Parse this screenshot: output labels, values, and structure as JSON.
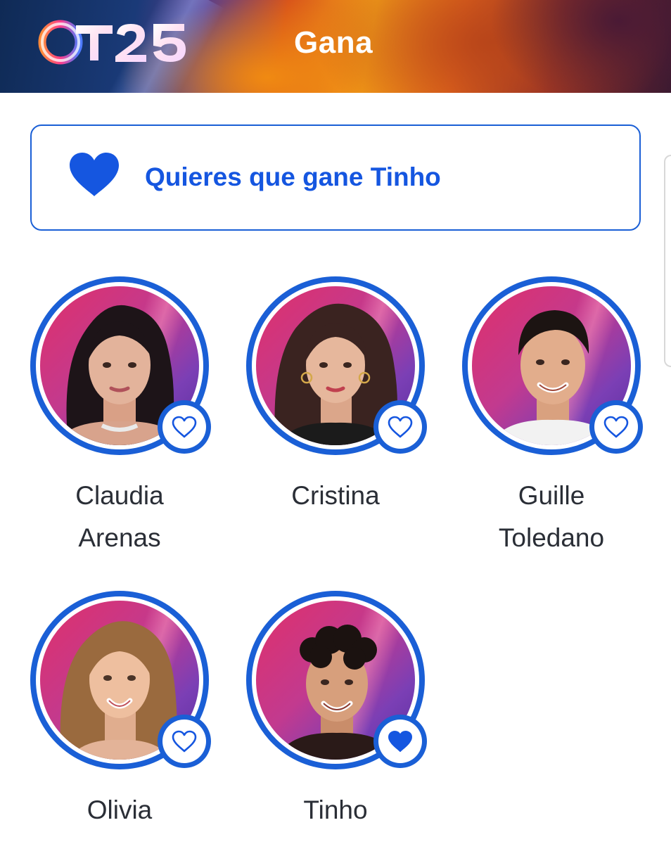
{
  "header": {
    "logo_text": "OT25",
    "title": "Gana"
  },
  "vote_banner": {
    "icon": "heart-filled-icon",
    "text": "Quieres que gane Tinho"
  },
  "colors": {
    "accent": "#1a5fd6",
    "banner_text": "#1556e0",
    "name_text": "#2a2e36"
  },
  "contestants": [
    {
      "name_line1": "Claudia",
      "name_line2": "Arenas",
      "favorite": false,
      "icon": "heart-outline-icon"
    },
    {
      "name_line1": "Cristina",
      "name_line2": "",
      "favorite": false,
      "icon": "heart-outline-icon"
    },
    {
      "name_line1": "Guille",
      "name_line2": "Toledano",
      "favorite": false,
      "icon": "heart-outline-icon"
    },
    {
      "name_line1": "Olivia",
      "name_line2": "",
      "favorite": false,
      "icon": "heart-outline-icon"
    },
    {
      "name_line1": "Tinho",
      "name_line2": "",
      "favorite": true,
      "icon": "heart-filled-icon"
    }
  ]
}
